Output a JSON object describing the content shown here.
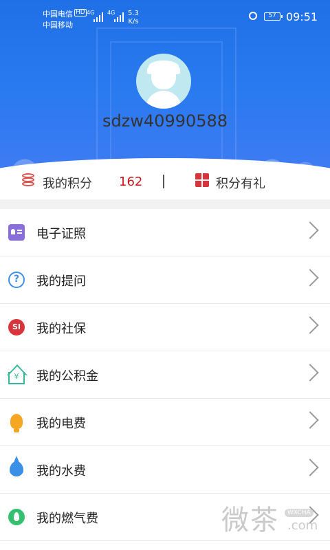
{
  "status_bar": {
    "carrier1": "中国电信",
    "carrier2": "中国移动",
    "hd_badge": "HD",
    "net1": "4G",
    "net2": "4G",
    "speed_value": "5.3",
    "speed_unit": "K/s",
    "battery": "57",
    "time": "09:51"
  },
  "profile": {
    "username": "sdzw40990588",
    "avatar_icon": "user-avatar-icon"
  },
  "points": {
    "label": "我的积分",
    "value": "162",
    "gift_label": "积分有礼",
    "accent_color": "#c8161d"
  },
  "menu": [
    {
      "label": "电子证照",
      "icon": "id-card-icon"
    },
    {
      "label": "我的提问",
      "icon": "question-icon"
    },
    {
      "label": "我的社保",
      "icon": "social-security-icon"
    },
    {
      "label": "我的公积金",
      "icon": "housing-fund-icon"
    },
    {
      "label": "我的电费",
      "icon": "lightbulb-icon"
    },
    {
      "label": "我的水费",
      "icon": "water-drop-icon"
    },
    {
      "label": "我的燃气费",
      "icon": "flame-icon"
    }
  ],
  "icon_glyphs": {
    "question": "?",
    "social_security": "SI",
    "housing_fund": "¥"
  },
  "watermark": {
    "big": "微茶",
    "small1": "WXCHA",
    "small2": ".com"
  },
  "colors": {
    "header_blue": "#2a7af0",
    "points_red": "#c8161d"
  }
}
